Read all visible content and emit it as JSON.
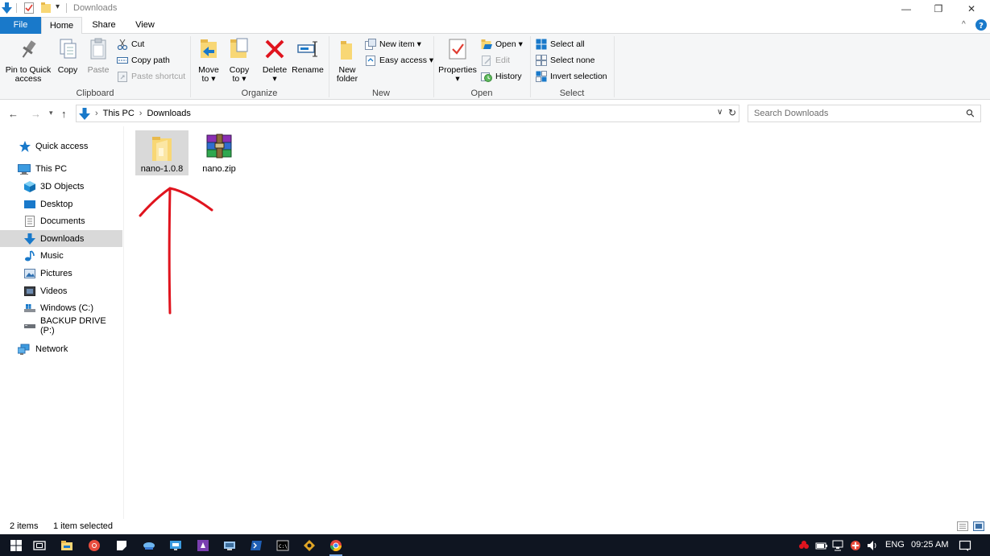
{
  "window": {
    "title": "Downloads",
    "minimize_glyph": "—",
    "maximize_glyph": "❐",
    "close_glyph": "✕"
  },
  "ribbon_tabs": [
    {
      "label": "File"
    },
    {
      "label": "Home"
    },
    {
      "label": "Share"
    },
    {
      "label": "View"
    }
  ],
  "ribbon": {
    "clipboard": {
      "label": "Clipboard",
      "pin_label_1": "Pin to Quick",
      "pin_label_2": "access",
      "copy_label": "Copy",
      "paste_label": "Paste",
      "cut_label": "Cut",
      "copy_path_label": "Copy path",
      "paste_shortcut_label": "Paste shortcut"
    },
    "organize": {
      "label": "Organize",
      "move_label_1": "Move",
      "move_label_2": "to ▾",
      "copyto_label_1": "Copy",
      "copyto_label_2": "to ▾",
      "delete_label": "Delete",
      "delete_arrow": "▾",
      "rename_label": "Rename"
    },
    "new": {
      "label": "New",
      "new_folder_1": "New",
      "new_folder_2": "folder",
      "new_item_label": "New item ▾",
      "easy_access_label": "Easy access ▾"
    },
    "open": {
      "label": "Open",
      "properties_label": "Properties",
      "properties_arrow": "▾",
      "open_label": "Open ▾",
      "edit_label": "Edit",
      "history_label": "History"
    },
    "select": {
      "label": "Select",
      "select_all_label": "Select all",
      "select_none_label": "Select none",
      "invert_label": "Invert selection"
    }
  },
  "address": {
    "back_glyph": "←",
    "forward_glyph": "→",
    "recent_glyph": "▾",
    "up_glyph": "↑",
    "crumb_sep": "›",
    "crumbs": [
      "This PC",
      "Downloads"
    ],
    "dropdown_glyph": "∨",
    "refresh_glyph": "↻"
  },
  "search": {
    "placeholder": "Search Downloads",
    "search_glyph": "⚲"
  },
  "nav_pane": {
    "items": [
      {
        "label": "Quick access"
      },
      {
        "label": "This PC"
      },
      {
        "label": "3D Objects"
      },
      {
        "label": "Desktop"
      },
      {
        "label": "Documents"
      },
      {
        "label": "Downloads"
      },
      {
        "label": "Music"
      },
      {
        "label": "Pictures"
      },
      {
        "label": "Videos"
      },
      {
        "label": "Windows (C:)"
      },
      {
        "label": "BACKUP DRIVE (P:)"
      },
      {
        "label": "Network"
      }
    ]
  },
  "files": [
    {
      "name": "nano-1.0.8",
      "type": "folder",
      "selected": true
    },
    {
      "name": "nano.zip",
      "type": "winrar-archive",
      "selected": false
    }
  ],
  "status": {
    "item_count": "2 items",
    "selection": "1 item selected"
  },
  "tray": {
    "language": "ENG",
    "time": "09:25 AM"
  },
  "colors": {
    "accent": "#1979ca",
    "ribbon_bg": "#f5f6f7",
    "selected_bg": "#d9d9d9",
    "taskbar_bg": "#0f1521",
    "annotation_red": "#e0141e"
  }
}
